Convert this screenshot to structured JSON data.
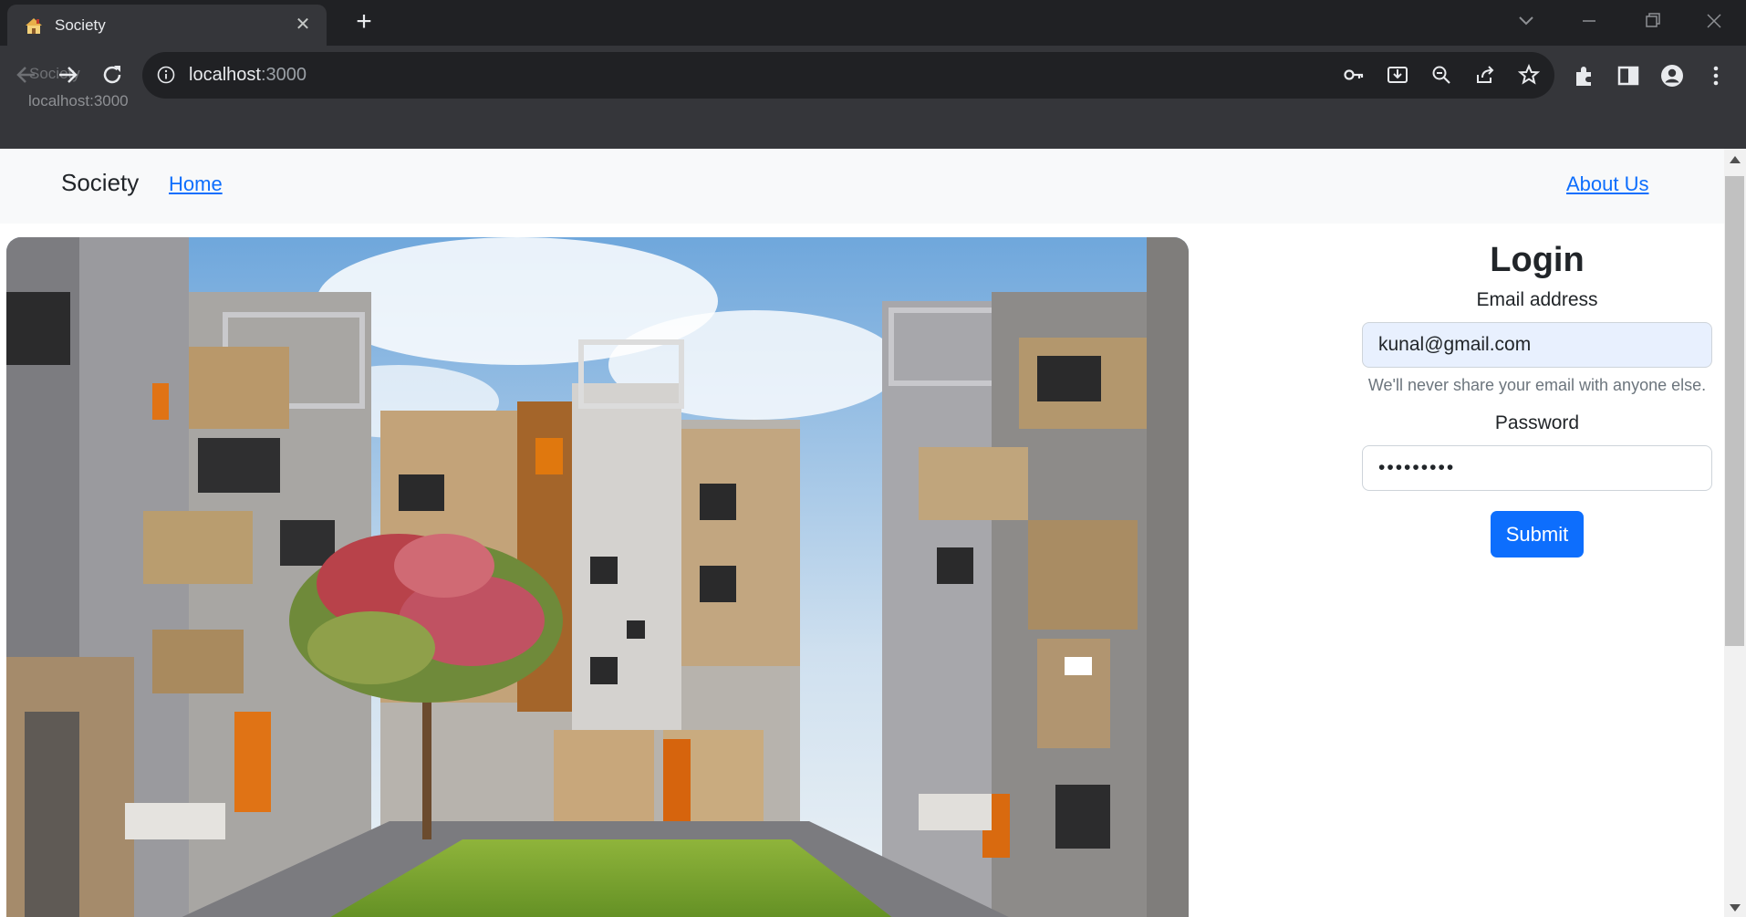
{
  "browser": {
    "tab": {
      "title": "Society",
      "favicon": "house-favicon"
    },
    "new_tab_icon": "plus-icon",
    "url_host": "localhost",
    "url_port": ":3000",
    "tooltip": "localhost:3000",
    "ghost_title": "Society",
    "icons": [
      "back-arrow-icon",
      "forward-arrow-icon",
      "reload-icon",
      "site-info-icon",
      "key-icon",
      "install-icon",
      "zoom-out-icon",
      "share-icon",
      "bookmark-star-icon",
      "extensions-icon",
      "side-panel-icon",
      "profile-icon",
      "kebab-menu-icon",
      "tab-search-icon",
      "minimize-icon",
      "restore-icon",
      "close-window-icon"
    ]
  },
  "navbar": {
    "brand": "Society",
    "home": "Home",
    "about": "About Us"
  },
  "hero": {
    "alt": "society-building-image"
  },
  "login": {
    "title": "Login",
    "email_label": "Email address",
    "email_value": "kunal@gmail.com",
    "email_help": "We'll never share your email with anyone else.",
    "password_label": "Password",
    "password_value": "•••••••••",
    "submit": "Submit"
  },
  "colors": {
    "chrome": "#35363a",
    "tabstrip": "#202124",
    "link": "#0d6efd",
    "submit_bg": "#0d6efd",
    "autofill_bg": "#e8f0fe",
    "navbar_bg": "#f8f9fa"
  }
}
